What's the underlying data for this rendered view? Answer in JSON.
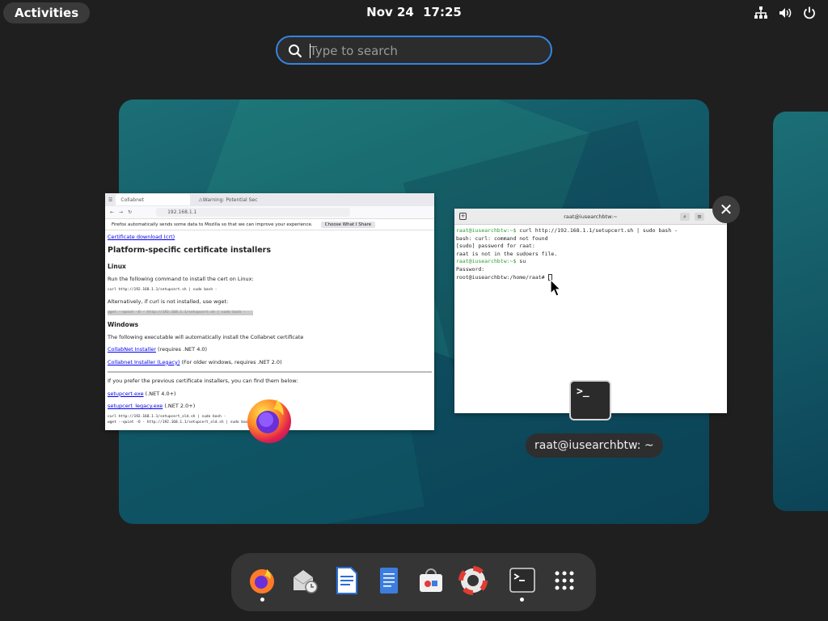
{
  "topbar": {
    "activities": "Activities",
    "date": "Nov 24",
    "time": "17:25",
    "tray_icons": [
      "network-icon",
      "volume-icon",
      "power-icon"
    ]
  },
  "search": {
    "placeholder": "Type to search",
    "value": ""
  },
  "firefox_window": {
    "tabs": [
      "Collabnet",
      "Warning: Potential Sec"
    ],
    "url": "192.168.1.1",
    "notice": "Firefox automatically sends some data to Mozilla so that we can improve your experience.",
    "notice_button": "Choose What I Share",
    "cert_link": "Certificate download (crt)",
    "heading": "Platform-specific certificate installers",
    "linux_heading": "Linux",
    "linux_text": "Run the following command to install the cert on Linux:",
    "linux_cmd": "curl http://192.168.1.1/setupcert.sh | sudo bash -",
    "wget_text": "Alternatively, if curl is not installed, use wget:",
    "wget_cmd": "wget --quiet -O - http://192.168.1.1/setupcert.sh | sudo bash -",
    "windows_heading": "Windows",
    "windows_text": "The following executable will automatically install the Collabnet certificate",
    "installer1_link": "CollabNet Installer",
    "installer1_note": "(requires .NET 4.0)",
    "installer2_link": "Collabnet Installer (Legacy)",
    "installer2_note": "(For older windows, requires .NET 2.0)",
    "prev_text": "If you prefer the previous certificate installers, you can find them below:",
    "setup1_link": "setupcert.exe",
    "setup1_note": "(.NET 4.0+)",
    "setup2_link": "setupcert_legacy.exe",
    "setup2_note": "(.NET 2.0+)",
    "cmd3": "curl http://192.168.1.1/setupcert_old.sh | sudo bash -",
    "cmd4": "wget --quiet -O - http://192.168.1.1/setupcert_old.sh | sudo bash -"
  },
  "terminal_window": {
    "title": "raat@iusearchbtw:~",
    "lines": [
      {
        "prompt": "raat@iusearchbtw:~$ ",
        "text": "curl http://192.168.1.1/setupcert.sh | sudo bash -"
      },
      {
        "prompt": "",
        "text": "bash: curl: command not found"
      },
      {
        "prompt": "",
        "text": "[sudo] password for raat:"
      },
      {
        "prompt": "",
        "text": "raat is not in the sudoers file."
      },
      {
        "prompt": "raat@iusearchbtw:~$ ",
        "text": "su"
      },
      {
        "prompt": "",
        "text": "Password:"
      },
      {
        "prompt": "",
        "text": "root@iusearchbtw:/home/raat# "
      }
    ],
    "caption": "raat@iusearchbtw: ~"
  },
  "terminal_icon_glyph": ">_",
  "close_glyph": "✕",
  "dash": {
    "items": [
      {
        "name": "firefox-icon",
        "running": true
      },
      {
        "name": "calendar-mail-icon",
        "running": false
      },
      {
        "name": "writer-document-icon",
        "running": false
      },
      {
        "name": "text-editor-icon",
        "running": false
      },
      {
        "name": "software-store-icon",
        "running": false
      },
      {
        "name": "help-lifebuoy-icon",
        "running": false
      },
      {
        "name": "terminal-icon",
        "running": true
      },
      {
        "name": "app-grid-icon",
        "running": false
      }
    ]
  },
  "colors": {
    "accent": "#3584e4",
    "wallpaper": "#135a68",
    "prompt_green": "#2a9d2a"
  }
}
